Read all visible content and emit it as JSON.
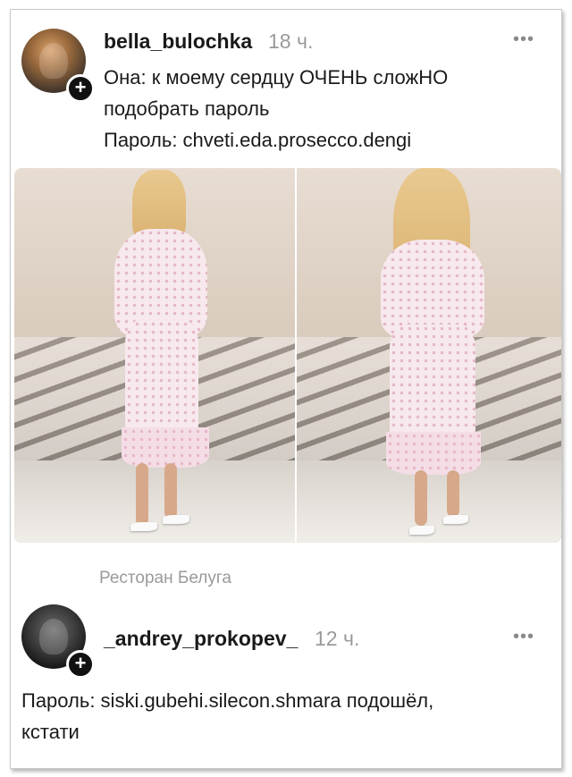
{
  "post": {
    "username": "bella_bulochka",
    "time": "18 ч.",
    "menu": "•••",
    "lines": [
      "Она: к моему сердцу ОЧЕНЬ сложНО",
      "подобрать пароль",
      "Пароль: chveti.eda.prosecco.dengi"
    ],
    "location": "Ресторан Белуга"
  },
  "reply": {
    "username": "_andrey_prokopev_",
    "time": "12 ч.",
    "menu": "•••",
    "lines": [
      "Пароль: siski.gubehi.silecon.shmara подошёл,",
      "кстати"
    ]
  },
  "icons": {
    "follow": "plus-icon",
    "more": "more-icon"
  }
}
